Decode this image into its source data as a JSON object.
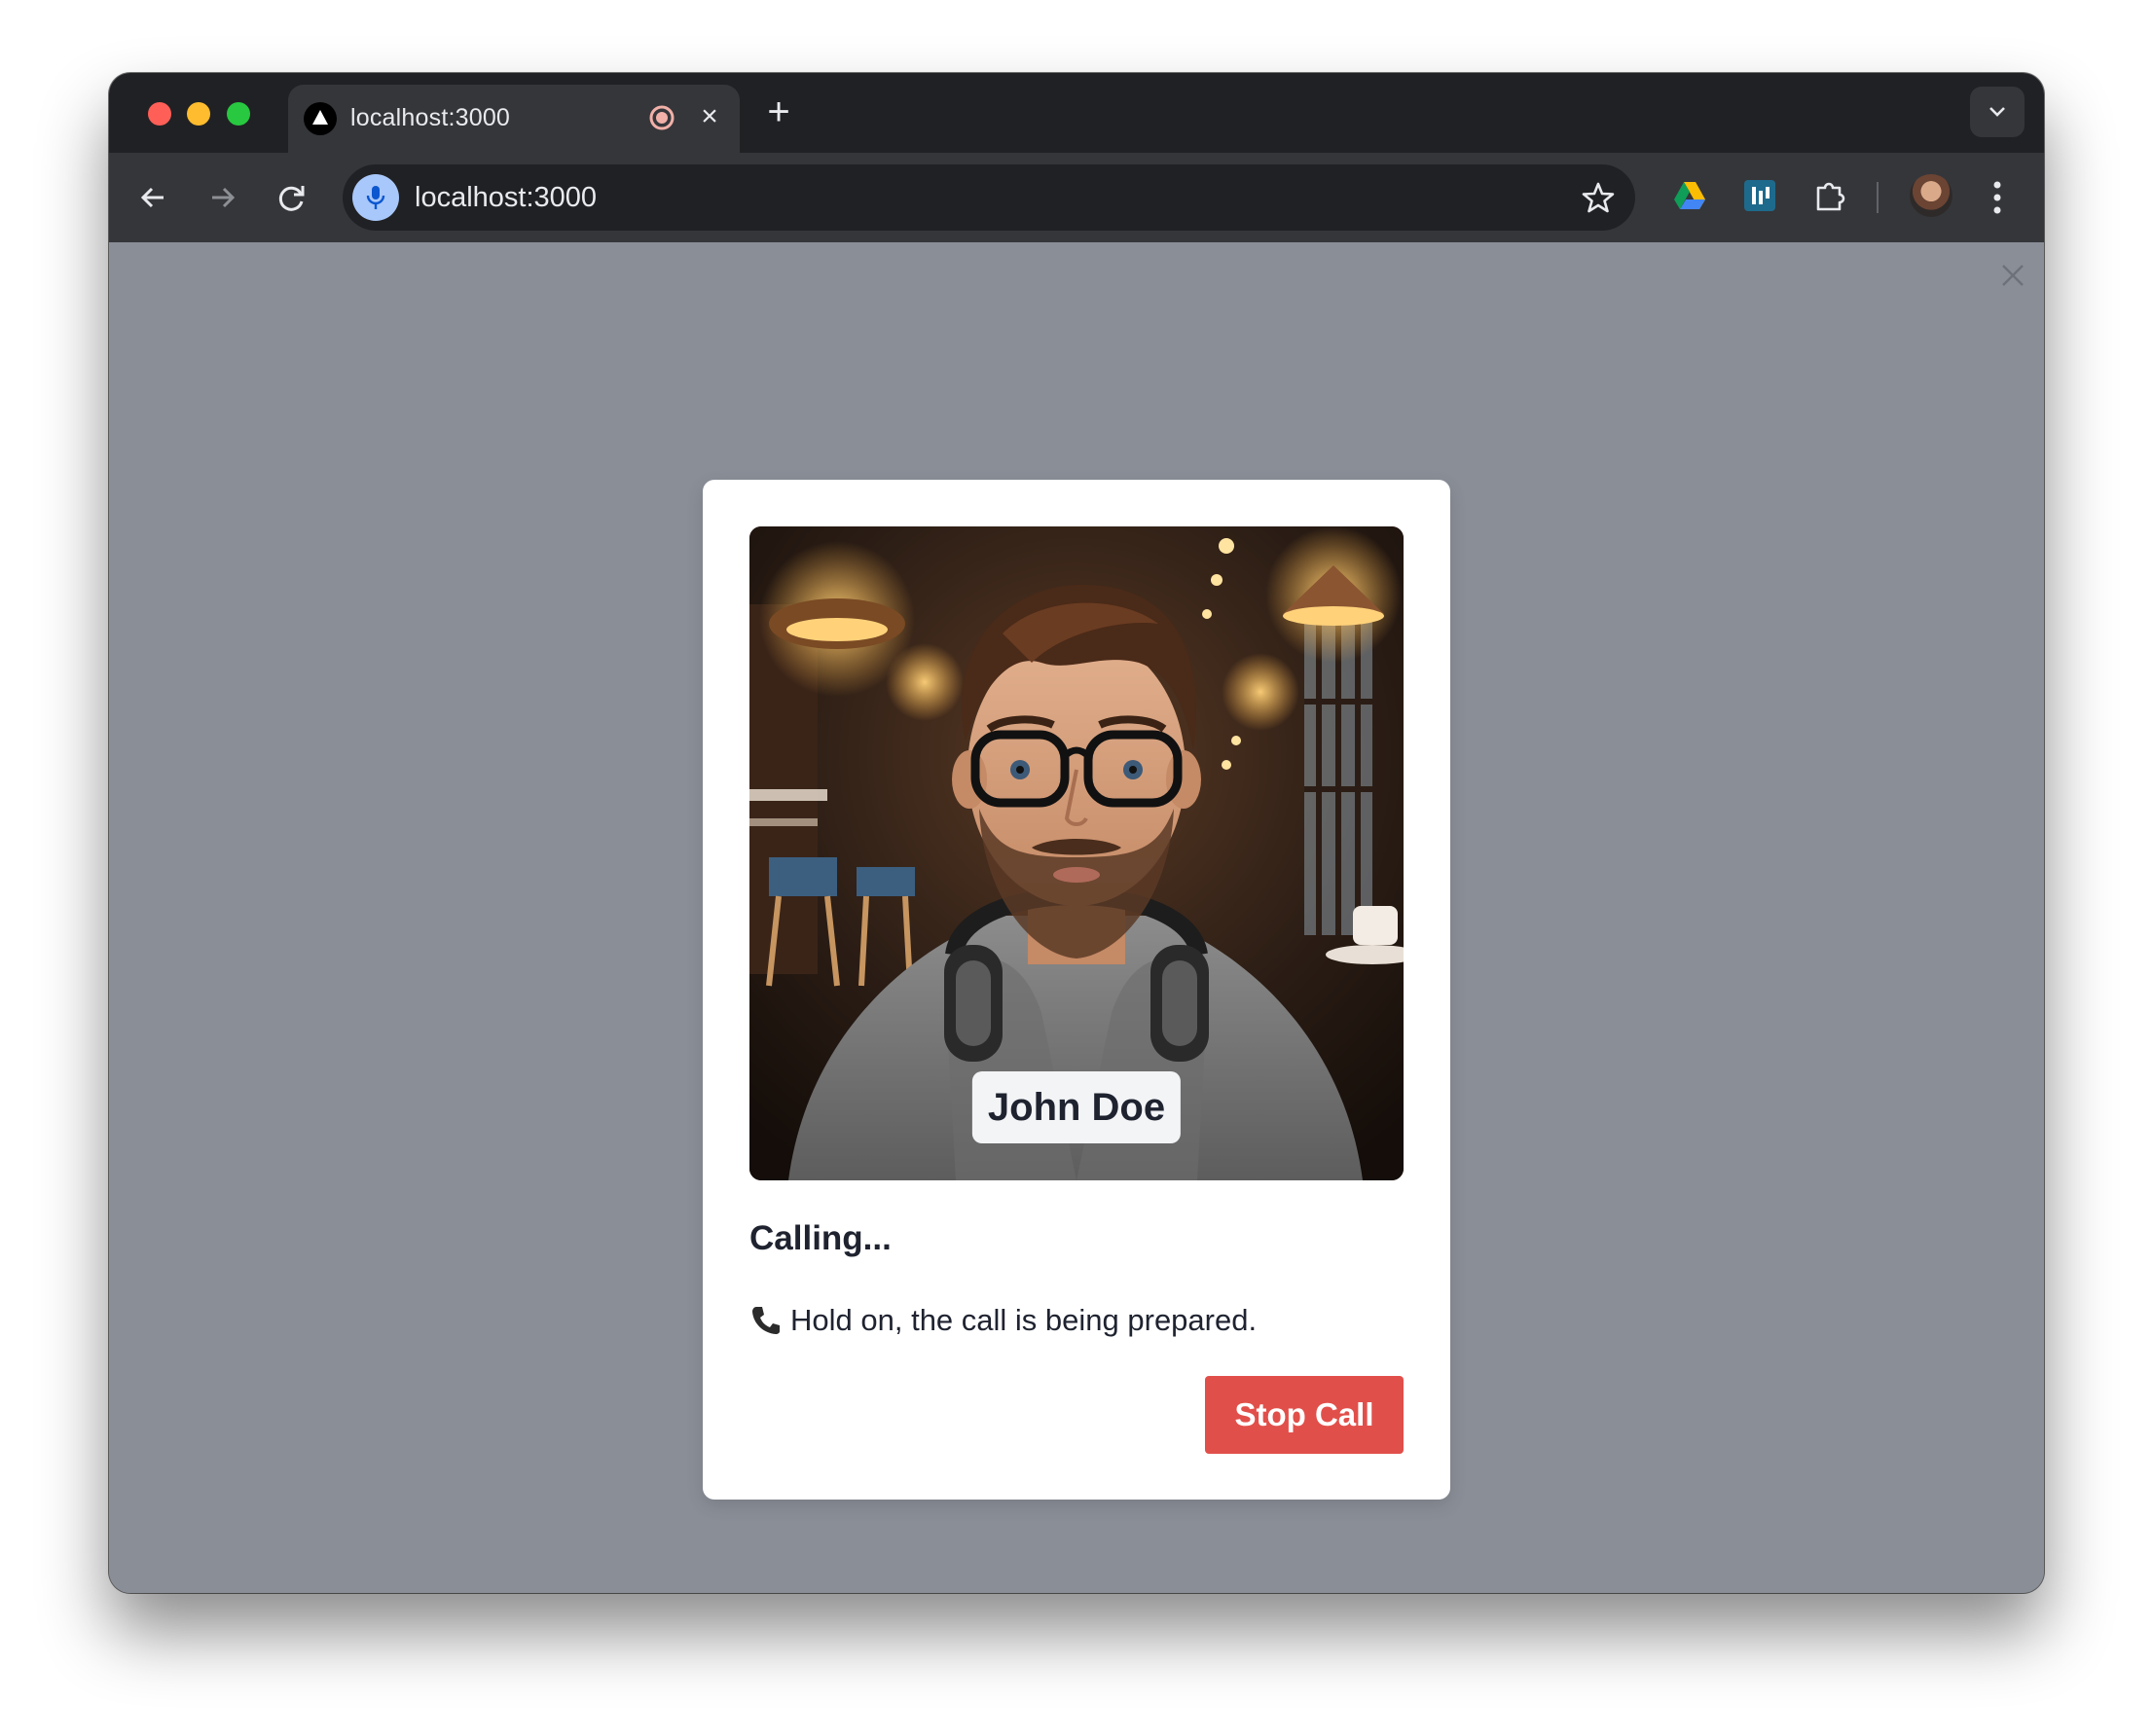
{
  "browser": {
    "tab": {
      "title": "localhost:3000",
      "favicon": "triangle-logo-icon",
      "recording_icon": "recording-icon",
      "close_icon": "close-icon"
    },
    "new_tab_icon": "plus-icon",
    "url": "localhost:3000",
    "toolbar_icons": [
      "back-arrow-icon",
      "forward-arrow-icon",
      "reload-icon",
      "mic-icon",
      "star-icon",
      "google-drive-icon",
      "extension-icon",
      "puzzle-icon",
      "profile-avatar",
      "more-vert-icon"
    ]
  },
  "call_modal": {
    "contact_name": "John Doe",
    "status_title": "Calling...",
    "status_message": "Hold on, the call is being prepared.",
    "stop_button_label": "Stop Call",
    "colors": {
      "stop_button": "#e14f4a",
      "overlay": "#8a8e97",
      "text": "#1f2330"
    }
  }
}
